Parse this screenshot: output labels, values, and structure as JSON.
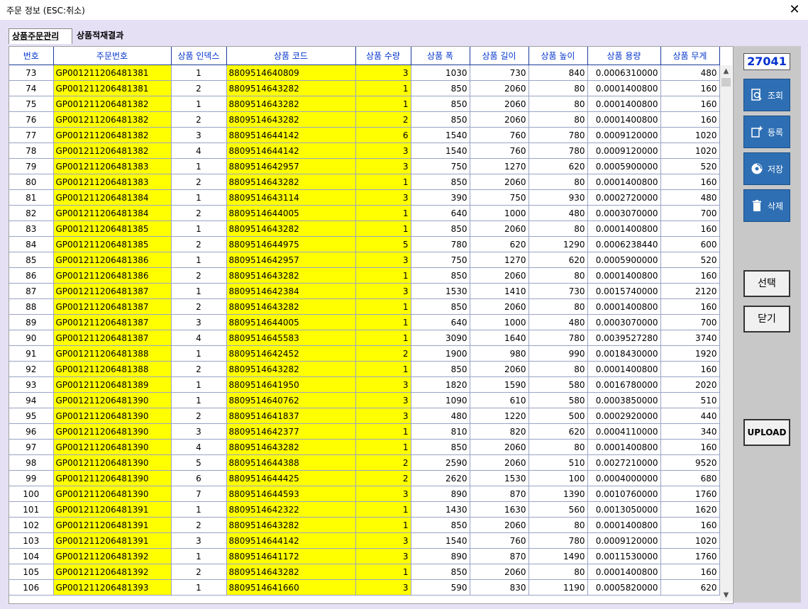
{
  "window": {
    "title": "주문 정보 (ESC:취소)"
  },
  "tabs": [
    {
      "label": "상품주문관리"
    },
    {
      "label": "상품적재결과"
    }
  ],
  "table": {
    "headers": [
      "번호",
      "주문번호",
      "상품 인덱스",
      "상품 코드",
      "상품 수량",
      "상품 폭",
      "상품 길이",
      "상품 높이",
      "상품 용량",
      "상품 무게"
    ],
    "rows": [
      [
        "73",
        "GP001211206481381",
        "1",
        "8809514640809",
        "3",
        "1030",
        "730",
        "840",
        "0.0006310000",
        "480"
      ],
      [
        "74",
        "GP001211206481381",
        "2",
        "8809514643282",
        "1",
        "850",
        "2060",
        "80",
        "0.0001400800",
        "160"
      ],
      [
        "75",
        "GP001211206481382",
        "1",
        "8809514643282",
        "1",
        "850",
        "2060",
        "80",
        "0.0001400800",
        "160"
      ],
      [
        "76",
        "GP001211206481382",
        "2",
        "8809514643282",
        "2",
        "850",
        "2060",
        "80",
        "0.0001400800",
        "160"
      ],
      [
        "77",
        "GP001211206481382",
        "3",
        "8809514644142",
        "6",
        "1540",
        "760",
        "780",
        "0.0009120000",
        "1020"
      ],
      [
        "78",
        "GP001211206481382",
        "4",
        "8809514644142",
        "3",
        "1540",
        "760",
        "780",
        "0.0009120000",
        "1020"
      ],
      [
        "79",
        "GP001211206481383",
        "1",
        "8809514642957",
        "3",
        "750",
        "1270",
        "620",
        "0.0005900000",
        "520"
      ],
      [
        "80",
        "GP001211206481383",
        "2",
        "8809514643282",
        "1",
        "850",
        "2060",
        "80",
        "0.0001400800",
        "160"
      ],
      [
        "81",
        "GP001211206481384",
        "1",
        "8809514643114",
        "3",
        "390",
        "750",
        "930",
        "0.0002720000",
        "480"
      ],
      [
        "82",
        "GP001211206481384",
        "2",
        "8809514644005",
        "1",
        "640",
        "1000",
        "480",
        "0.0003070000",
        "700"
      ],
      [
        "83",
        "GP001211206481385",
        "1",
        "8809514643282",
        "1",
        "850",
        "2060",
        "80",
        "0.0001400800",
        "160"
      ],
      [
        "84",
        "GP001211206481385",
        "2",
        "8809514644975",
        "5",
        "780",
        "620",
        "1290",
        "0.0006238440",
        "600"
      ],
      [
        "85",
        "GP001211206481386",
        "1",
        "8809514642957",
        "3",
        "750",
        "1270",
        "620",
        "0.0005900000",
        "520"
      ],
      [
        "86",
        "GP001211206481386",
        "2",
        "8809514643282",
        "1",
        "850",
        "2060",
        "80",
        "0.0001400800",
        "160"
      ],
      [
        "87",
        "GP001211206481387",
        "1",
        "8809514642384",
        "3",
        "1530",
        "1410",
        "730",
        "0.0015740000",
        "2120"
      ],
      [
        "88",
        "GP001211206481387",
        "2",
        "8809514643282",
        "1",
        "850",
        "2060",
        "80",
        "0.0001400800",
        "160"
      ],
      [
        "89",
        "GP001211206481387",
        "3",
        "8809514644005",
        "1",
        "640",
        "1000",
        "480",
        "0.0003070000",
        "700"
      ],
      [
        "90",
        "GP001211206481387",
        "4",
        "8809514645583",
        "1",
        "3090",
        "1640",
        "780",
        "0.0039527280",
        "3740"
      ],
      [
        "91",
        "GP001211206481388",
        "1",
        "8809514642452",
        "2",
        "1900",
        "980",
        "990",
        "0.0018430000",
        "1920"
      ],
      [
        "92",
        "GP001211206481388",
        "2",
        "8809514643282",
        "1",
        "850",
        "2060",
        "80",
        "0.0001400800",
        "160"
      ],
      [
        "93",
        "GP001211206481389",
        "1",
        "8809514641950",
        "3",
        "1820",
        "1590",
        "580",
        "0.0016780000",
        "2020"
      ],
      [
        "94",
        "GP001211206481390",
        "1",
        "8809514640762",
        "3",
        "1090",
        "610",
        "580",
        "0.0003850000",
        "510"
      ],
      [
        "95",
        "GP001211206481390",
        "2",
        "8809514641837",
        "3",
        "480",
        "1220",
        "500",
        "0.0002920000",
        "440"
      ],
      [
        "96",
        "GP001211206481390",
        "3",
        "8809514642377",
        "1",
        "810",
        "820",
        "620",
        "0.0004110000",
        "340"
      ],
      [
        "97",
        "GP001211206481390",
        "4",
        "8809514643282",
        "1",
        "850",
        "2060",
        "80",
        "0.0001400800",
        "160"
      ],
      [
        "98",
        "GP001211206481390",
        "5",
        "8809514644388",
        "2",
        "2590",
        "2060",
        "510",
        "0.0027210000",
        "9520"
      ],
      [
        "99",
        "GP001211206481390",
        "6",
        "8809514644425",
        "2",
        "2620",
        "1530",
        "100",
        "0.0004000000",
        "680"
      ],
      [
        "100",
        "GP001211206481390",
        "7",
        "8809514644593",
        "3",
        "890",
        "870",
        "1390",
        "0.0010760000",
        "1760"
      ],
      [
        "101",
        "GP001211206481391",
        "1",
        "8809514642322",
        "1",
        "1430",
        "1630",
        "560",
        "0.0013050000",
        "1620"
      ],
      [
        "102",
        "GP001211206481391",
        "2",
        "8809514643282",
        "1",
        "850",
        "2060",
        "80",
        "0.0001400800",
        "160"
      ],
      [
        "103",
        "GP001211206481391",
        "3",
        "8809514644142",
        "3",
        "1540",
        "760",
        "780",
        "0.0009120000",
        "1020"
      ],
      [
        "104",
        "GP001211206481392",
        "1",
        "8809514641172",
        "3",
        "890",
        "870",
        "1490",
        "0.0011530000",
        "1760"
      ],
      [
        "105",
        "GP001211206481392",
        "2",
        "8809514643282",
        "1",
        "850",
        "2060",
        "80",
        "0.0001400800",
        "160"
      ],
      [
        "106",
        "GP001211206481393",
        "1",
        "8809514641660",
        "3",
        "590",
        "830",
        "1190",
        "0.0005820000",
        "620"
      ]
    ]
  },
  "side": {
    "counter": "27041",
    "buttons": [
      {
        "label": "조회",
        "icon": "search-doc-icon"
      },
      {
        "label": "등록",
        "icon": "add-doc-icon"
      },
      {
        "label": "저장",
        "icon": "save-disc-icon"
      },
      {
        "label": "삭제",
        "icon": "trash-icon"
      }
    ],
    "select_label": "선택",
    "close_label": "닫기",
    "upload_label": "UPLOAD"
  },
  "colors": {
    "highlight_bg": "#ffff00",
    "highlight_text": "#e0102a",
    "header_text": "#0033cc",
    "action_button": "#2e6fb4"
  }
}
